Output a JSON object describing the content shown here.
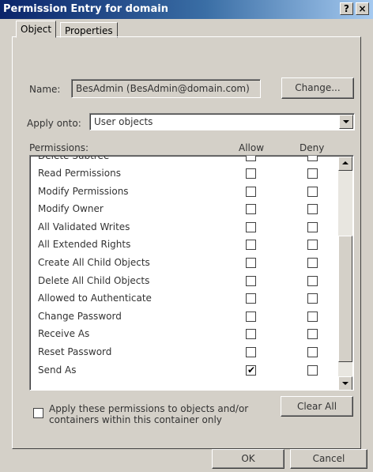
{
  "window": {
    "title": "Permission Entry for domain",
    "help_label": "?",
    "close_label": "×"
  },
  "tabs": [
    {
      "label": "Object",
      "active": true
    },
    {
      "label": "Properties",
      "active": false
    }
  ],
  "name_field": {
    "label": "Name:",
    "value": "BesAdmin (BesAdmin@domain.com)",
    "change_button": "Change..."
  },
  "apply_onto": {
    "label": "Apply onto:",
    "selected": "User objects"
  },
  "permissions": {
    "header_label": "Permissions:",
    "allow_header": "Allow",
    "deny_header": "Deny",
    "partial_top_item": "Delete Subtree",
    "rows": [
      {
        "name": "Read Permissions",
        "allow": false,
        "deny": false
      },
      {
        "name": "Modify Permissions",
        "allow": false,
        "deny": false
      },
      {
        "name": "Modify Owner",
        "allow": false,
        "deny": false
      },
      {
        "name": "All Validated Writes",
        "allow": false,
        "deny": false
      },
      {
        "name": "All Extended Rights",
        "allow": false,
        "deny": false
      },
      {
        "name": "Create All Child Objects",
        "allow": false,
        "deny": false
      },
      {
        "name": "Delete All Child Objects",
        "allow": false,
        "deny": false
      },
      {
        "name": "Allowed to Authenticate",
        "allow": false,
        "deny": false
      },
      {
        "name": "Change Password",
        "allow": false,
        "deny": false
      },
      {
        "name": "Receive As",
        "allow": false,
        "deny": false
      },
      {
        "name": "Reset Password",
        "allow": false,
        "deny": false
      },
      {
        "name": "Send As",
        "allow": true,
        "deny": false
      }
    ]
  },
  "apply_checkbox": {
    "checked": false,
    "line1": "Apply these permissions to objects and/or",
    "line2": "containers within this container only"
  },
  "clear_all_button": "Clear All",
  "ok_button": "OK",
  "cancel_button": "Cancel",
  "check_glyph": "✔"
}
